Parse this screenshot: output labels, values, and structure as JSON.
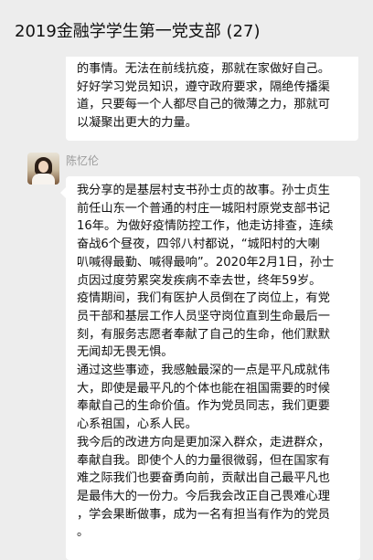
{
  "header": {
    "title": "2019金融学学生第一党支部 (27)"
  },
  "messages": [
    {
      "type": "received",
      "lines": [
        "的事情。无法在前线抗疫，那就在家做好自己。",
        "好好学习党员知识，遵守政府要求，隔绝传播渠",
        "道，只要每一个人都尽自己的微薄之力，那就可",
        "以凝聚出更大的力量。"
      ]
    },
    {
      "type": "received",
      "sender": "陈忆伦",
      "lines": [
        "我分享的是基层村支书孙士贞的故事。孙士贞生",
        "前任山东一个普通的村庄一城阳村原党支部书记",
        "16年。为做好疫情防控工作，他走访排查，连续",
        "奋战6个昼夜，四邻八村都说，“城阳村的大喇",
        "叭喊得最勤、喊得最响”。2020年2月1日，孙士",
        "贞因过度劳累突发疾病不幸去世，终年59岁。",
        "疫情期间，我们有医护人员倒在了岗位上，有党",
        "员干部和基层工作人员坚守岗位直到生命最后一",
        "刻，有服务志愿者奉献了自己的生命，他们默默",
        "无闻却无畏无惧。",
        "通过这些事迹，我感触最深的一点是平凡成就伟",
        "大，即使是最平凡的个体也能在祖国需要的时候",
        "奉献自己的生命价值。作为党员同志，我们更要",
        "心系祖国，心系人民。",
        "我今后的改进方向是更加深入群众，走进群众，",
        "奉献自我。即使个人的力量很微弱，但在国家有",
        "难之际我们也要奋勇向前，贡献出自己最平凡也",
        "是最伟大的一份力。今后我会改正自己畏难心理",
        "，学会果断做事，成为一名有担当有作为的党员",
        "。"
      ]
    }
  ]
}
